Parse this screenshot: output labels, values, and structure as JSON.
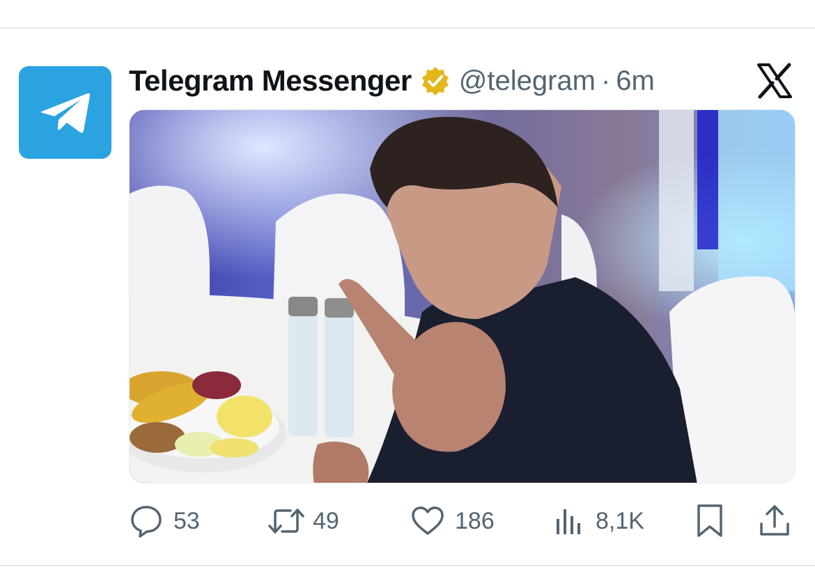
{
  "author": {
    "display_name": "Telegram Messenger",
    "handle": "@telegram",
    "separator": "·",
    "time": "6m",
    "avatar_icon": "telegram-paper-plane-icon",
    "avatar_color": "#2aa3e0",
    "verified_badge": "gold-verified-badge-icon",
    "verified_color": "#e2b719"
  },
  "platform_logo": "x-logo-icon",
  "media": {
    "type": "photo"
  },
  "actions": {
    "replies": "53",
    "reposts": "49",
    "likes": "186",
    "views": "8,1K"
  },
  "colors": {
    "text_primary": "#0f1419",
    "text_secondary": "#536471",
    "divider": "#e7e9ea"
  }
}
